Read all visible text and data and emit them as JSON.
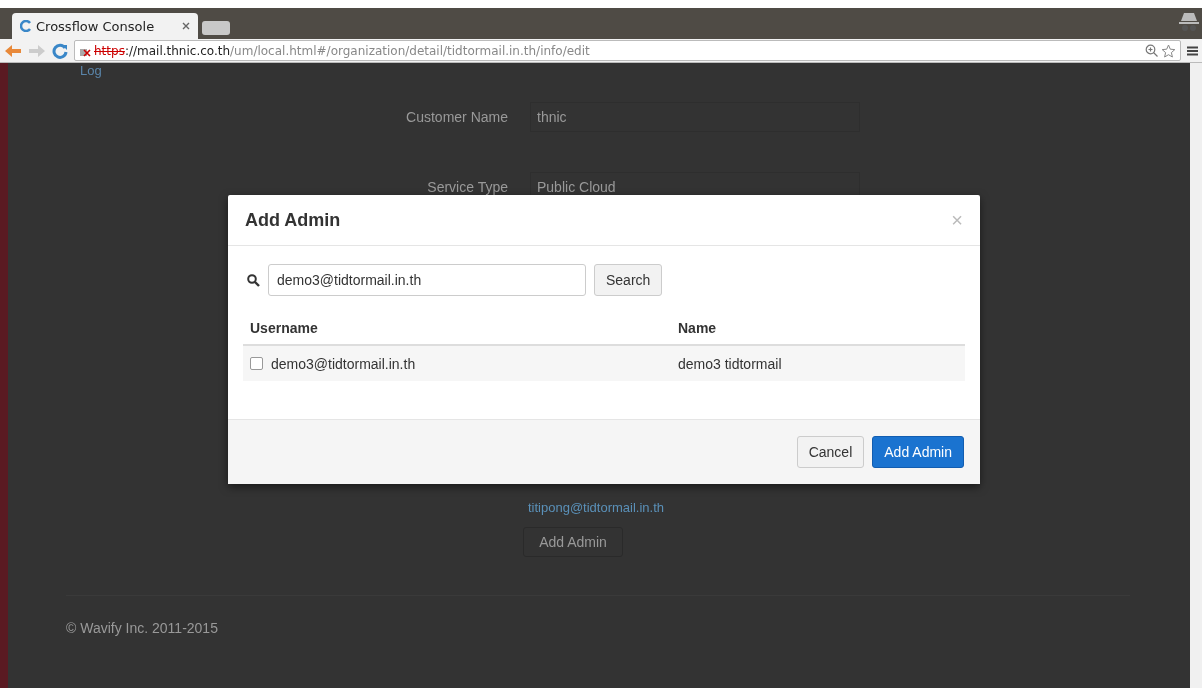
{
  "browser": {
    "tab_title": "Crossflow Console",
    "url_scheme": "https",
    "url_host": "://mail.thnic.co.th",
    "url_path": "/um/local.html#/organization/detail/tidtormail.in.th/info/edit"
  },
  "page": {
    "side_link": "Log",
    "fields": [
      {
        "label": "Customer Name",
        "value": "thnic"
      },
      {
        "label": "Service Type",
        "value": "Public Cloud"
      }
    ],
    "admin_link": "titipong@tidtormail.in.th",
    "add_button": "Add Admin",
    "footer": "© Wavify Inc. 2011-2015"
  },
  "dialog": {
    "title": "Add Admin",
    "close": "×",
    "search_value": "demo3@tidtormail.in.th",
    "search_button": "Search",
    "columns": [
      "Username",
      "Name"
    ],
    "rows": [
      {
        "username": "demo3@tidtormail.in.th",
        "name": "demo3 tidtormail",
        "checked": false
      }
    ],
    "buttons": [
      {
        "label": "Cancel",
        "kind": "default"
      },
      {
        "label": "Add Admin",
        "kind": "primary"
      }
    ]
  }
}
